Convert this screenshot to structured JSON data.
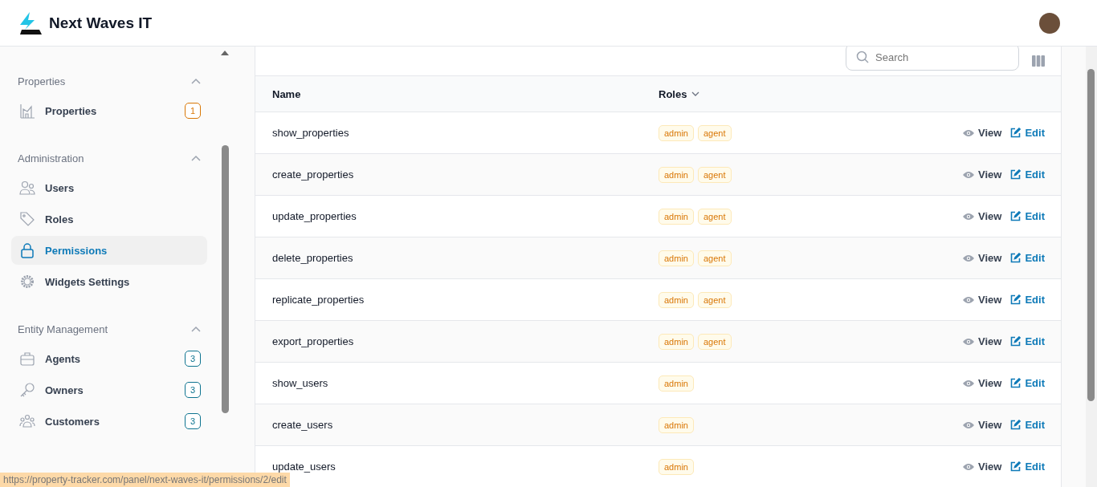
{
  "brand": {
    "name": "Next Waves IT"
  },
  "sidebar": {
    "sections": [
      {
        "title": "Properties",
        "expanded": true,
        "items": [
          {
            "label": "Properties",
            "selected": false,
            "badge": "1",
            "color": "#d97706"
          }
        ]
      },
      {
        "title": "Administration",
        "expanded": true,
        "items": [
          {
            "label": "Users",
            "selected": false
          },
          {
            "label": "Roles",
            "selected": false
          },
          {
            "label": "Permissions",
            "selected": true
          },
          {
            "label": "Widgets Settings",
            "selected": false
          }
        ]
      },
      {
        "title": "Entity Management",
        "expanded": true,
        "items": [
          {
            "label": "Agents",
            "selected": false,
            "badge": "3",
            "color": "#0e7490"
          },
          {
            "label": "Owners",
            "selected": false,
            "badge": "3",
            "color": "#0e7490"
          },
          {
            "label": "Customers",
            "selected": false,
            "badge": "3",
            "color": "#0e7490"
          }
        ]
      }
    ]
  },
  "table": {
    "search": {
      "placeholder": "Search"
    },
    "columns": [
      {
        "label": "Name",
        "sortable": false
      },
      {
        "label": "Roles",
        "sortable": true
      }
    ],
    "rows": [
      {
        "name": "show_properties",
        "roles": [
          "admin",
          "agent"
        ],
        "actions": [
          "View",
          "Edit"
        ]
      },
      {
        "name": "create_properties",
        "roles": [
          "admin",
          "agent"
        ],
        "actions": [
          "View",
          "Edit"
        ]
      },
      {
        "name": "update_properties",
        "roles": [
          "admin",
          "agent"
        ],
        "actions": [
          "View",
          "Edit"
        ]
      },
      {
        "name": "delete_properties",
        "roles": [
          "admin",
          "agent"
        ],
        "actions": [
          "View",
          "Edit"
        ]
      },
      {
        "name": "replicate_properties",
        "roles": [
          "admin",
          "agent"
        ],
        "actions": [
          "View",
          "Edit"
        ]
      },
      {
        "name": "export_properties",
        "roles": [
          "admin",
          "agent"
        ],
        "actions": [
          "View",
          "Edit"
        ]
      },
      {
        "name": "show_users",
        "roles": [
          "admin"
        ],
        "actions": [
          "View",
          "Edit"
        ]
      },
      {
        "name": "create_users",
        "roles": [
          "admin"
        ],
        "actions": [
          "View",
          "Edit"
        ]
      },
      {
        "name": "update_users",
        "roles": [
          "admin"
        ],
        "actions": [
          "View",
          "Edit"
        ]
      }
    ]
  },
  "status_bar": {
    "url": "https://property-tracker.com/panel/next-waves-it/permissions/2/edit"
  }
}
